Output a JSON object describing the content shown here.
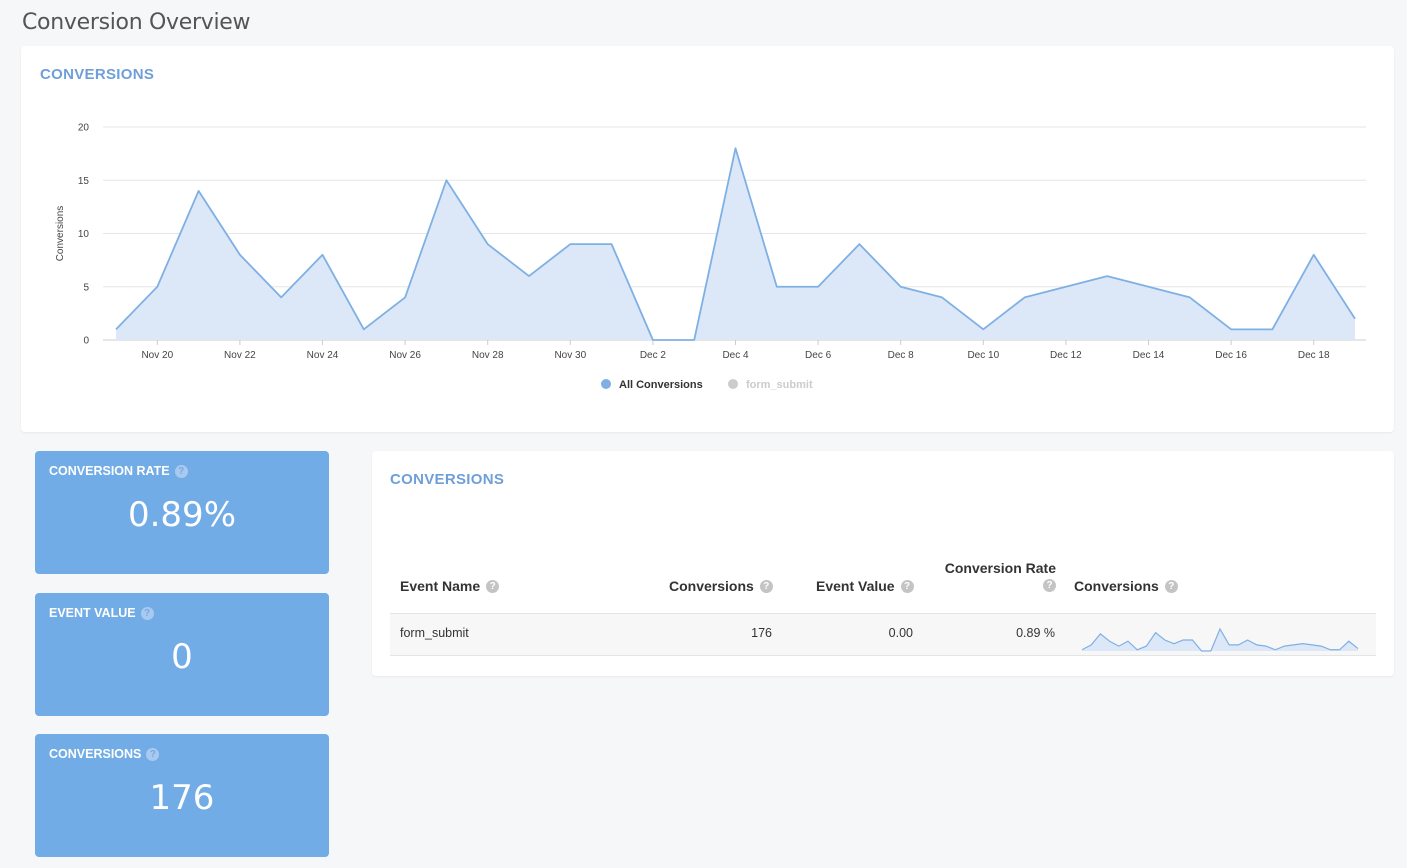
{
  "page": {
    "title": "Conversion Overview"
  },
  "chart_card": {
    "title": "CONVERSIONS"
  },
  "chart_data": {
    "type": "area",
    "ylabel": "Conversions",
    "ylim": [
      0,
      20
    ],
    "yticks": [
      0,
      5,
      10,
      15,
      20
    ],
    "x": [
      "Nov 19",
      "Nov 20",
      "Nov 21",
      "Nov 22",
      "Nov 23",
      "Nov 24",
      "Nov 25",
      "Nov 26",
      "Nov 27",
      "Nov 28",
      "Nov 29",
      "Nov 30",
      "Dec 1",
      "Dec 2",
      "Dec 3",
      "Dec 4",
      "Dec 5",
      "Dec 6",
      "Dec 7",
      "Dec 8",
      "Dec 9",
      "Dec 10",
      "Dec 11",
      "Dec 12",
      "Dec 13",
      "Dec 14",
      "Dec 15",
      "Dec 16",
      "Dec 17",
      "Dec 18",
      "Dec 19"
    ],
    "xtick_labels": [
      "Nov 20",
      "Nov 22",
      "Nov 24",
      "Nov 26",
      "Nov 28",
      "Nov 30",
      "Dec 2",
      "Dec 4",
      "Dec 6",
      "Dec 8",
      "Dec 10",
      "Dec 12",
      "Dec 14",
      "Dec 16",
      "Dec 18"
    ],
    "series": [
      {
        "name": "All Conversions",
        "color": "#7fb0e4",
        "fill": "#dce8f7",
        "visible": true,
        "values": [
          1,
          5,
          14,
          8,
          4,
          8,
          1,
          4,
          15,
          9,
          6,
          9,
          9,
          0,
          0,
          18,
          5,
          5,
          9,
          5,
          4,
          1,
          4,
          5,
          6,
          5,
          4,
          1,
          1,
          8,
          2
        ]
      },
      {
        "name": "form_submit",
        "color": "#cccccc",
        "visible": false
      }
    ],
    "legend": "bottom-center",
    "grid": true
  },
  "kpis": [
    {
      "label": "CONVERSION RATE",
      "value": "0.89%"
    },
    {
      "label": "EVENT VALUE",
      "value": "0"
    },
    {
      "label": "CONVERSIONS",
      "value": "176"
    }
  ],
  "table": {
    "title": "CONVERSIONS",
    "headers": {
      "event_name": "Event Name",
      "conversions": "Conversions",
      "event_value": "Event Value",
      "conversion_rate": "Conversion Rate",
      "sparkline": "Conversions"
    },
    "rows": [
      {
        "event_name": "form_submit",
        "conversions": "176",
        "event_value": "0.00",
        "conversion_rate": "0.89 %"
      }
    ]
  },
  "icons": {
    "help": "help-circle-icon"
  }
}
